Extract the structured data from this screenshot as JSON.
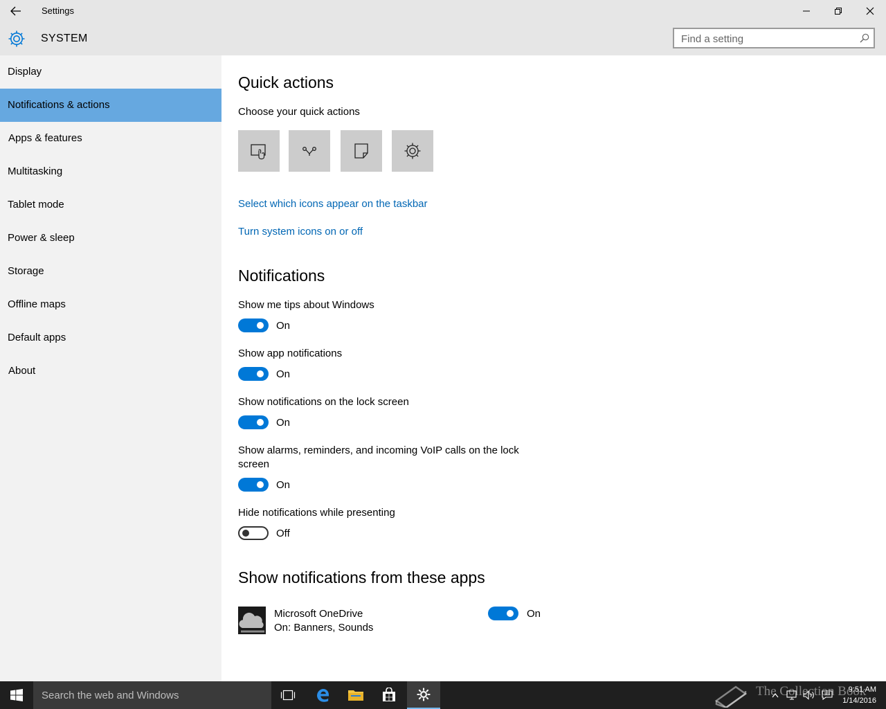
{
  "window": {
    "title": "Settings"
  },
  "header": {
    "section": "SYSTEM",
    "search_placeholder": "Find a setting"
  },
  "sidebar": {
    "items": [
      {
        "label": "Display"
      },
      {
        "label": "Notifications & actions"
      },
      {
        "label": "Apps & features"
      },
      {
        "label": "Multitasking"
      },
      {
        "label": "Tablet mode"
      },
      {
        "label": "Power & sleep"
      },
      {
        "label": "Storage"
      },
      {
        "label": "Offline maps"
      },
      {
        "label": "Default apps"
      },
      {
        "label": "About"
      }
    ],
    "active_index": 1
  },
  "quick_actions": {
    "heading": "Quick actions",
    "subheading": "Choose your quick actions",
    "tiles": [
      "tablet-mode-icon",
      "connect-icon",
      "note-icon",
      "settings-icon"
    ],
    "link1": "Select which icons appear on the taskbar",
    "link2": "Turn system icons on or off"
  },
  "notifications": {
    "heading": "Notifications",
    "settings": [
      {
        "label": "Show me tips about Windows",
        "state": "On"
      },
      {
        "label": "Show app notifications",
        "state": "On"
      },
      {
        "label": "Show notifications on the lock screen",
        "state": "On"
      },
      {
        "label_line1": "Show alarms, reminders, and incoming VoIP calls on the lock",
        "label_line2": "screen",
        "state": "On"
      },
      {
        "label": "Hide notifications while presenting",
        "state": "Off"
      }
    ]
  },
  "apps": {
    "heading": "Show notifications from these apps",
    "items": [
      {
        "name": "Microsoft OneDrive",
        "detail": "On: Banners, Sounds",
        "state": "On"
      }
    ]
  },
  "taskbar": {
    "search_placeholder": "Search the web and Windows",
    "time": "9:51 AM",
    "date": "1/14/2016",
    "watermark": "The Collection Book"
  },
  "colors": {
    "accent": "#0078d7",
    "nav_selected": "#66a8e0",
    "link": "#0066b4"
  }
}
